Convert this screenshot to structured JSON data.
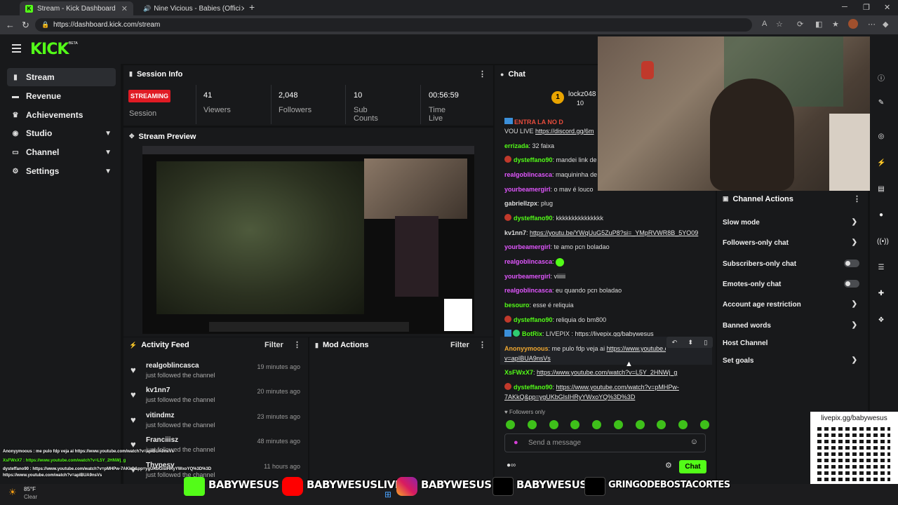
{
  "browser": {
    "tabs": [
      {
        "title": "Stream - Kick Dashboard",
        "active": true
      },
      {
        "title": "Nine Vicious - Babies (Offici",
        "active": false
      }
    ],
    "new_tab": "+",
    "url": "https://dashboard.kick.com/stream"
  },
  "app": {
    "logo": "KICK",
    "beta": "BETA"
  },
  "sidebar": {
    "items": [
      {
        "label": "Stream",
        "icon": "broadcast-icon",
        "active": true
      },
      {
        "label": "Revenue",
        "icon": "revenue-icon"
      },
      {
        "label": "Achievements",
        "icon": "trophy-icon"
      },
      {
        "label": "Studio",
        "icon": "studio-icon",
        "expandable": true
      },
      {
        "label": "Channel",
        "icon": "channel-icon",
        "expandable": true
      },
      {
        "label": "Settings",
        "icon": "gear-icon",
        "expandable": true
      }
    ]
  },
  "session": {
    "title": "Session Info",
    "status": "STREAMING",
    "status_label": "Session",
    "stats": [
      {
        "value": "41",
        "label": "Viewers"
      },
      {
        "value": "2,048",
        "label": "Followers"
      },
      {
        "value": "10",
        "label": "Sub Counts"
      },
      {
        "value": "00:56:59",
        "label": "Time Live"
      }
    ]
  },
  "preview": {
    "title": "Stream Preview"
  },
  "activity": {
    "title": "Activity Feed",
    "filter": "Filter",
    "items": [
      {
        "name": "realgoblincasca",
        "sub": "just followed the channel",
        "time": "19 minutes ago"
      },
      {
        "name": "kv1nn7",
        "sub": "just followed the channel",
        "time": "20 minutes ago"
      },
      {
        "name": "vitindmz",
        "sub": "just followed the channel",
        "time": "23 minutes ago"
      },
      {
        "name": "Franciiisz",
        "sub": "just followed the channel",
        "time": "48 minutes ago"
      },
      {
        "name": "Thypesy",
        "sub": "just followed the channel",
        "time": "11 hours ago"
      }
    ]
  },
  "mod": {
    "title": "Mod Actions",
    "filter": "Filter"
  },
  "chat": {
    "title": "Chat",
    "top_user": "lockz048",
    "top_count": "10",
    "messages": [
      {
        "user": "",
        "text": "ENTRA LA NO D",
        "color": "#e74c3c"
      },
      {
        "user": "",
        "text": "VOU LIVE ",
        "link": "https://discord.gg/6m",
        "color": "#ddd"
      },
      {
        "user": "errizada",
        "text": ": 32 faixa",
        "color": "#53fc18"
      },
      {
        "user": "dysteffano90",
        "text": ": mandei link de",
        "color": "#53fc18",
        "icon": true
      },
      {
        "user": "realgoblincasca",
        "text": ": maquininha de",
        "color": "#e056fd"
      },
      {
        "user": "yourbeamergirl",
        "text": ": o mav é louco",
        "color": "#e056fd"
      },
      {
        "user": "gabriellzpx",
        "text": ": plug",
        "color": "#ddd"
      },
      {
        "user": "dysteffano90",
        "text": ": kkkkkkkkkkkkkkk",
        "color": "#53fc18",
        "icon": true
      },
      {
        "user": "kv1nn7",
        "text": ": ",
        "link": "https://youtu.be/YWqUuG5ZuP8?si=_YMpRVWR8B_5YO09",
        "color": "#ddd"
      },
      {
        "user": "yourbeamergirl",
        "text": ": te amo pcn boladao",
        "color": "#e056fd"
      },
      {
        "user": "realgoblincasca",
        "text": ": ",
        "color": "#e056fd",
        "emote": true
      },
      {
        "user": "yourbeamergirl",
        "text": ": viiiiii",
        "color": "#e056fd"
      },
      {
        "user": "realgoblincasca",
        "text": ": eu quando pcn boladao",
        "color": "#e056fd"
      },
      {
        "user": "besouro",
        "text": ": esse é reliquia",
        "color": "#53fc18"
      },
      {
        "user": "dysteffano90",
        "text": ": reliquia do bm800",
        "color": "#53fc18",
        "icon": true
      },
      {
        "user": "BotRix",
        "text": ": LIVEPIX : ",
        "link": "https://livepix.gg/babywesus",
        "color": "#53fc18",
        "bot": true
      },
      {
        "user": "Anonyymoous",
        "text": ": me pulo fdp veja ai ",
        "link": "https://www.youtube.com/watch?",
        "color": "#f0a830"
      },
      {
        "user": "",
        "text": "",
        "link": "v=apIBUA9nsVs",
        "color": "#ddd"
      },
      {
        "user": "XsFWxX7",
        "text": ": ",
        "link": "https://www.youtube.com/watch?v=L5Y_2HNWj_g",
        "color": "#53fc18"
      },
      {
        "user": "dysteffano90",
        "text": ": ",
        "link": "https://www.youtube.com/watch?v=pMHPw-",
        "color": "#53fc18",
        "icon": true
      },
      {
        "user": "",
        "text": "",
        "link": "7AKkQ&pp=ygUKbGlsIHRyYWxoYQ%3D%3D",
        "color": "#ddd"
      }
    ],
    "followers_only": "Followers only",
    "input_placeholder": "Send a message",
    "send_label": "Chat"
  },
  "actions": {
    "title": "Channel Actions",
    "items": [
      {
        "label": "Slow mode",
        "type": "chevron"
      },
      {
        "label": "Followers-only chat",
        "type": "chevron"
      },
      {
        "label": "Subscribers-only chat",
        "type": "toggle"
      },
      {
        "label": "Emotes-only chat",
        "type": "toggle"
      },
      {
        "label": "Account age restriction",
        "type": "chevron"
      },
      {
        "label": "Banned words",
        "type": "chevron"
      },
      {
        "label": "Host Channel",
        "type": "none"
      },
      {
        "label": "Set goals",
        "type": "chevron"
      }
    ]
  },
  "overlay": {
    "qr_text": "livepix.gg/babywesus",
    "socials": [
      "BABYWESUS",
      "BABYWESUSLIVE",
      "BABYWESUS",
      "BABYWESUS",
      "GRINGODEBOSTACORTES"
    ],
    "ticker": [
      "Anonyymoous : me pulo fdp veja ai https://www.youtube.com/watch?v=apIBUA9nsVs",
      "XsFWxX7 : https://www.youtube.com/watch?v=L5Y_2HNWj_g",
      "dysteffano90 : https://www.youtube.com/watch?v=pMHPw-7AKkQ&pp=ygUKbGlsIHRyYWxoYQ%3D%3D",
      "https://www.youtube.com/watch?v=apIBUA9nsVs"
    ]
  },
  "taskbar": {
    "temp": "85°F",
    "weather": "Clear"
  }
}
